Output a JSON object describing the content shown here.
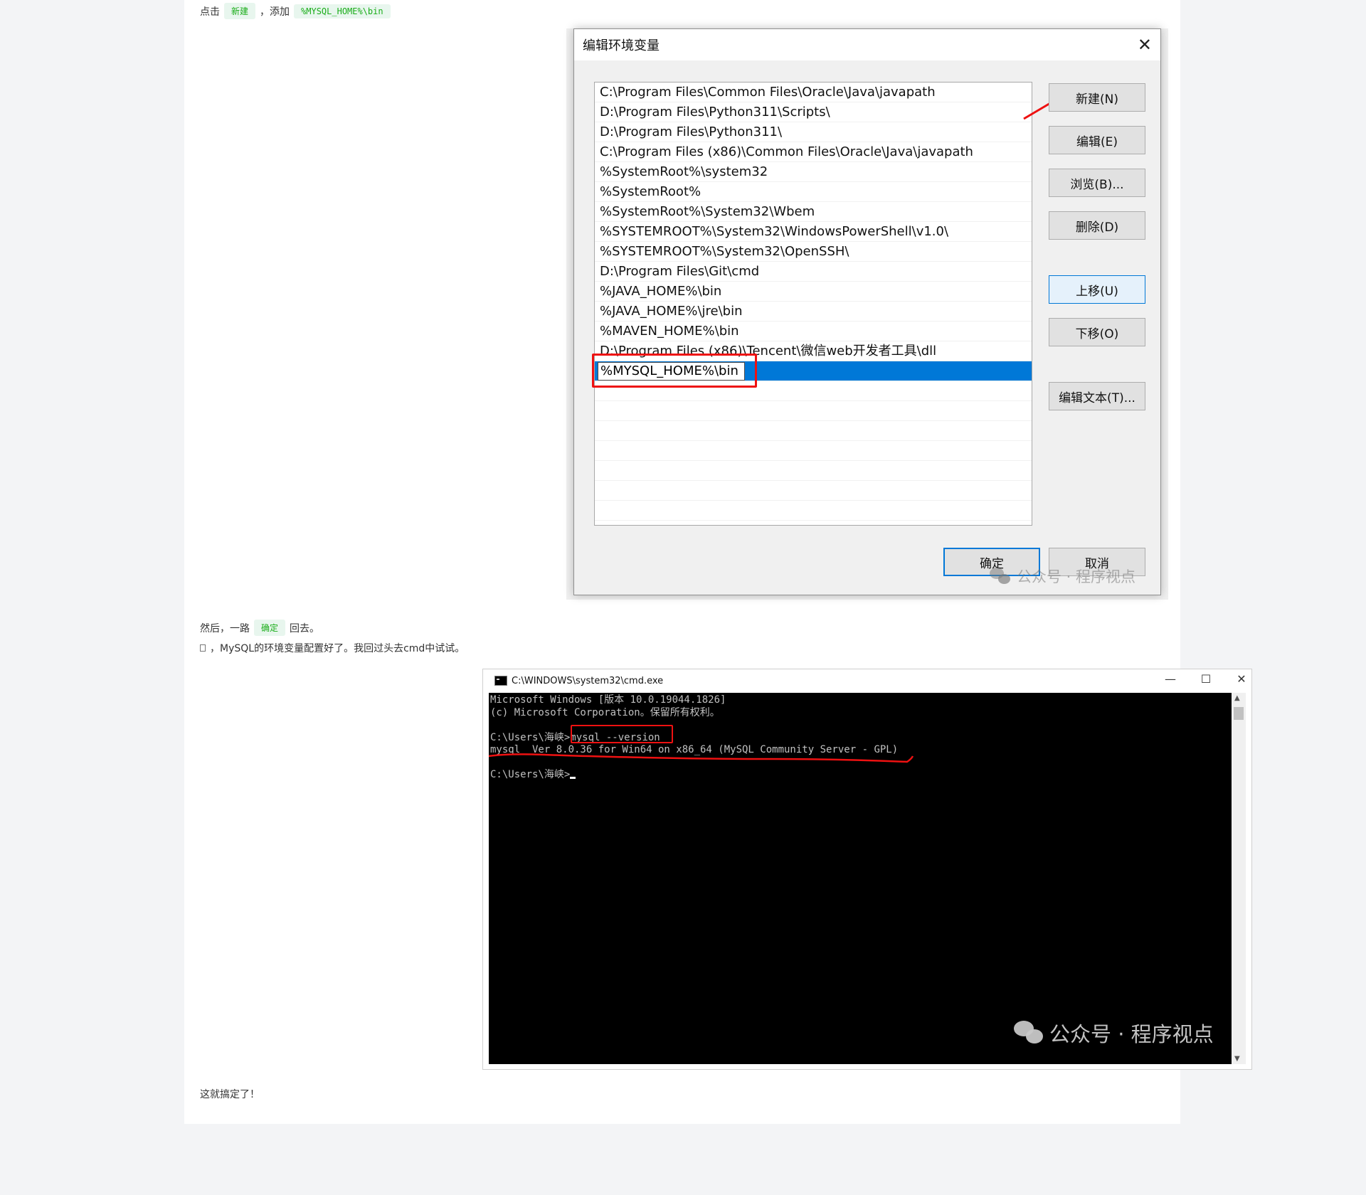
{
  "article": {
    "step1": {
      "prefix": "点击",
      "chip_new": "新建",
      "middle": "，添加",
      "chip_path": "%MYSQL_HOME%\\bin"
    },
    "step2": {
      "prefix": "然后，一路",
      "chip_ok": "确定",
      "suffix": "回去。"
    },
    "step3": "，MySQL的环境变量配置好了。我回过头去cmd中试试。",
    "step4": "这就搞定了！"
  },
  "dialog": {
    "title": "编辑环境变量",
    "paths": [
      "C:\\Program Files\\Common Files\\Oracle\\Java\\javapath",
      "D:\\Program Files\\Python311\\Scripts\\",
      "D:\\Program Files\\Python311\\",
      "C:\\Program Files (x86)\\Common Files\\Oracle\\Java\\javapath",
      "%SystemRoot%\\system32",
      "%SystemRoot%",
      "%SystemRoot%\\System32\\Wbem",
      "%SYSTEMROOT%\\System32\\WindowsPowerShell\\v1.0\\",
      "%SYSTEMROOT%\\System32\\OpenSSH\\",
      "D:\\Program Files\\Git\\cmd",
      "%JAVA_HOME%\\bin",
      "%JAVA_HOME%\\jre\\bin",
      "%MAVEN_HOME%\\bin",
      "D:\\Program Files (x86)\\Tencent\\微信web开发者工具\\dll"
    ],
    "editing_value": "%MYSQL_HOME%\\bin",
    "buttons": {
      "new": "新建(N)",
      "edit": "编辑(E)",
      "browse": "浏览(B)...",
      "delete": "删除(D)",
      "move_up": "上移(U)",
      "move_down": "下移(O)",
      "edit_text": "编辑文本(T)...",
      "ok": "确定",
      "cancel": "取消"
    },
    "watermark": "公众号 · 程序视点"
  },
  "cmd": {
    "title": "C:\\WINDOWS\\system32\\cmd.exe",
    "line1": "Microsoft Windows [版本 10.0.19044.1826]",
    "line2": "(c) Microsoft Corporation。保留所有权利。",
    "prompt1": "C:\\Users\\海峡>",
    "command": "mysql --version",
    "output": "mysql  Ver 8.0.36 for Win64 on x86_64 (MySQL Community Server - GPL)",
    "prompt2": "C:\\Users\\海峡>",
    "watermark": "公众号 · 程序视点"
  },
  "colors": {
    "highlight_red": "#ee1111",
    "selection_blue": "#0078d7",
    "chip_green": "#1aad19"
  }
}
